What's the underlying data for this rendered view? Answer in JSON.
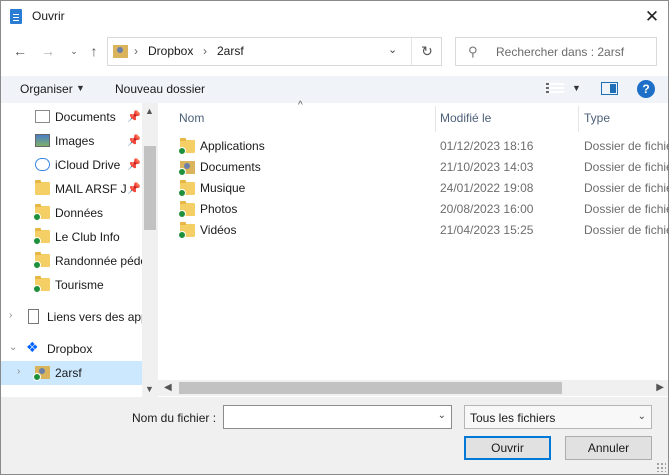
{
  "window": {
    "title": "Ouvrir",
    "close_glyph": "✕"
  },
  "address": {
    "segments": [
      "Dropbox",
      "2arsf"
    ],
    "separator": "›"
  },
  "search": {
    "placeholder": "Rechercher dans : 2arsf"
  },
  "toolbar": {
    "organize": "Organiser",
    "new_folder": "Nouveau dossier"
  },
  "nav": {
    "items": [
      {
        "label": "Documents",
        "icon": "documents-icon",
        "pinned": true
      },
      {
        "label": "Images",
        "icon": "images-icon",
        "pinned": true
      },
      {
        "label": "iCloud Drive",
        "icon": "icloud-icon",
        "pinned": true
      },
      {
        "label": "MAIL ARSF JE",
        "icon": "folder-icon",
        "pinned": true
      },
      {
        "label": "Données",
        "icon": "folder-sync-icon",
        "pinned": false
      },
      {
        "label": "Le Club Info",
        "icon": "folder-sync-icon",
        "pinned": false
      },
      {
        "label": "Randonnée péde",
        "icon": "folder-sync-icon",
        "pinned": false
      },
      {
        "label": "Tourisme",
        "icon": "folder-sync-icon",
        "pinned": false
      },
      {
        "label": "Liens vers des app",
        "icon": "page-icon",
        "pinned": false
      },
      {
        "label": "Dropbox",
        "icon": "dropbox-icon",
        "pinned": false
      },
      {
        "label": "2arsf",
        "icon": "user-folder-icon",
        "pinned": false,
        "selected": true
      }
    ]
  },
  "columns": {
    "name": "Nom",
    "modified": "Modifié le",
    "type": "Type"
  },
  "files": [
    {
      "name": "Applications",
      "modified": "01/12/2023 18:16",
      "type": "Dossier de fichiers"
    },
    {
      "name": "Documents",
      "modified": "21/10/2023 14:03",
      "type": "Dossier de fichiers"
    },
    {
      "name": "Musique",
      "modified": "24/01/2022 19:08",
      "type": "Dossier de fichiers"
    },
    {
      "name": "Photos",
      "modified": "20/08/2023 16:00",
      "type": "Dossier de fichiers"
    },
    {
      "name": "Vidéos",
      "modified": "21/04/2023 15:25",
      "type": "Dossier de fichiers"
    }
  ],
  "bottom": {
    "filename_label": "Nom du fichier :",
    "filename_value": "",
    "filter": "Tous les fichiers",
    "open": "Ouvrir",
    "cancel": "Annuler"
  }
}
